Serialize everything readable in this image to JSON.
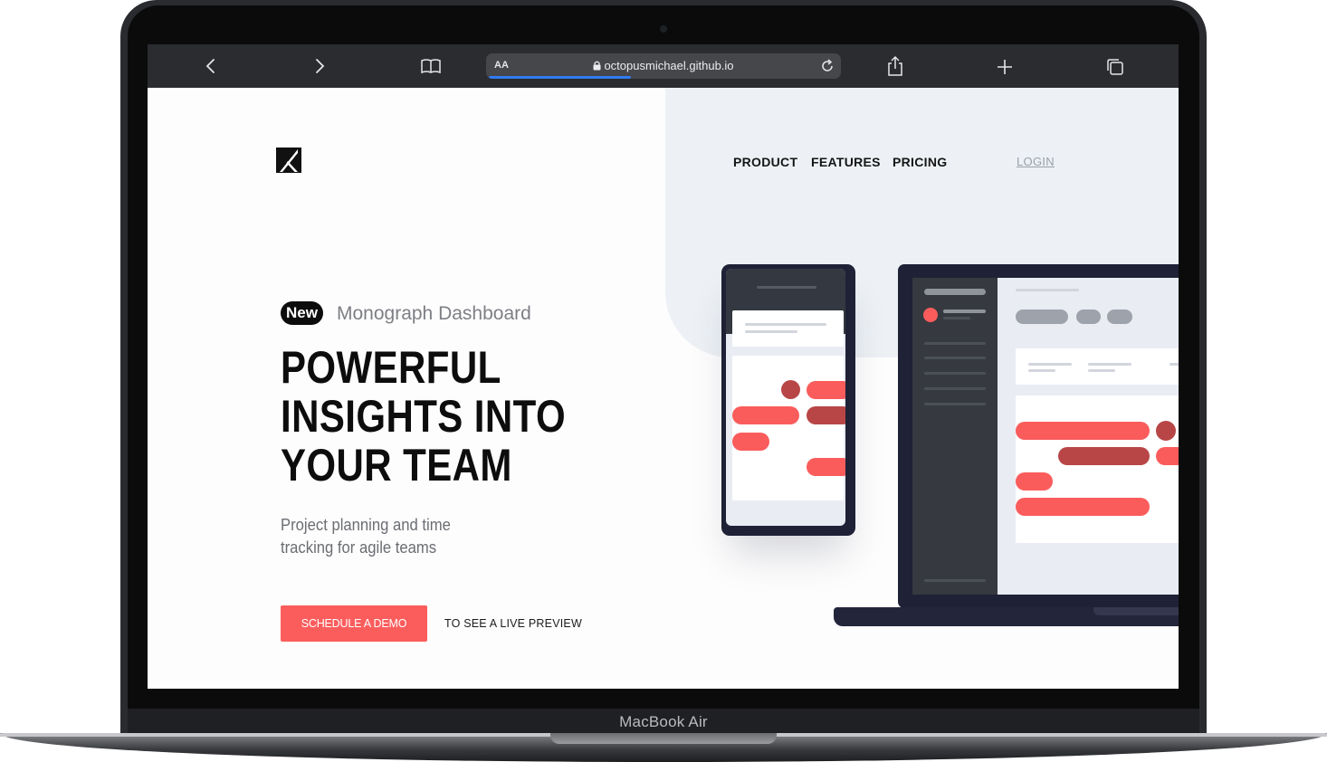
{
  "device": {
    "model_label": "MacBook Air"
  },
  "browser": {
    "reader_label": "AA",
    "url": "octopusmichael.github.io",
    "load_progress": 0.4,
    "icons": [
      "chevron-left-icon",
      "chevron-right-icon",
      "book-icon",
      "lock-icon",
      "reload-icon",
      "share-icon",
      "plus-icon",
      "tabs-icon"
    ]
  },
  "nav": {
    "items": [
      "PRODUCT",
      "FEATURES",
      "PRICING"
    ],
    "login": "LOGIN"
  },
  "hero": {
    "badge": "New",
    "badge_caption": "Monograph Dashboard",
    "headline": [
      "POWERFUL",
      "INSIGHTS INTO",
      "YOUR TEAM"
    ],
    "subtitle_lines": [
      "Project planning and time",
      "tracking for agile teams"
    ],
    "cta_label": "SCHEDULE A DEMO",
    "cta_note": "TO SEE A LIVE PREVIEW"
  },
  "colors": {
    "accent": "#fb5d5d",
    "accent_dark": "#b84646",
    "hero_bg": "#edf1f5",
    "device_frame": "#1f2136"
  }
}
